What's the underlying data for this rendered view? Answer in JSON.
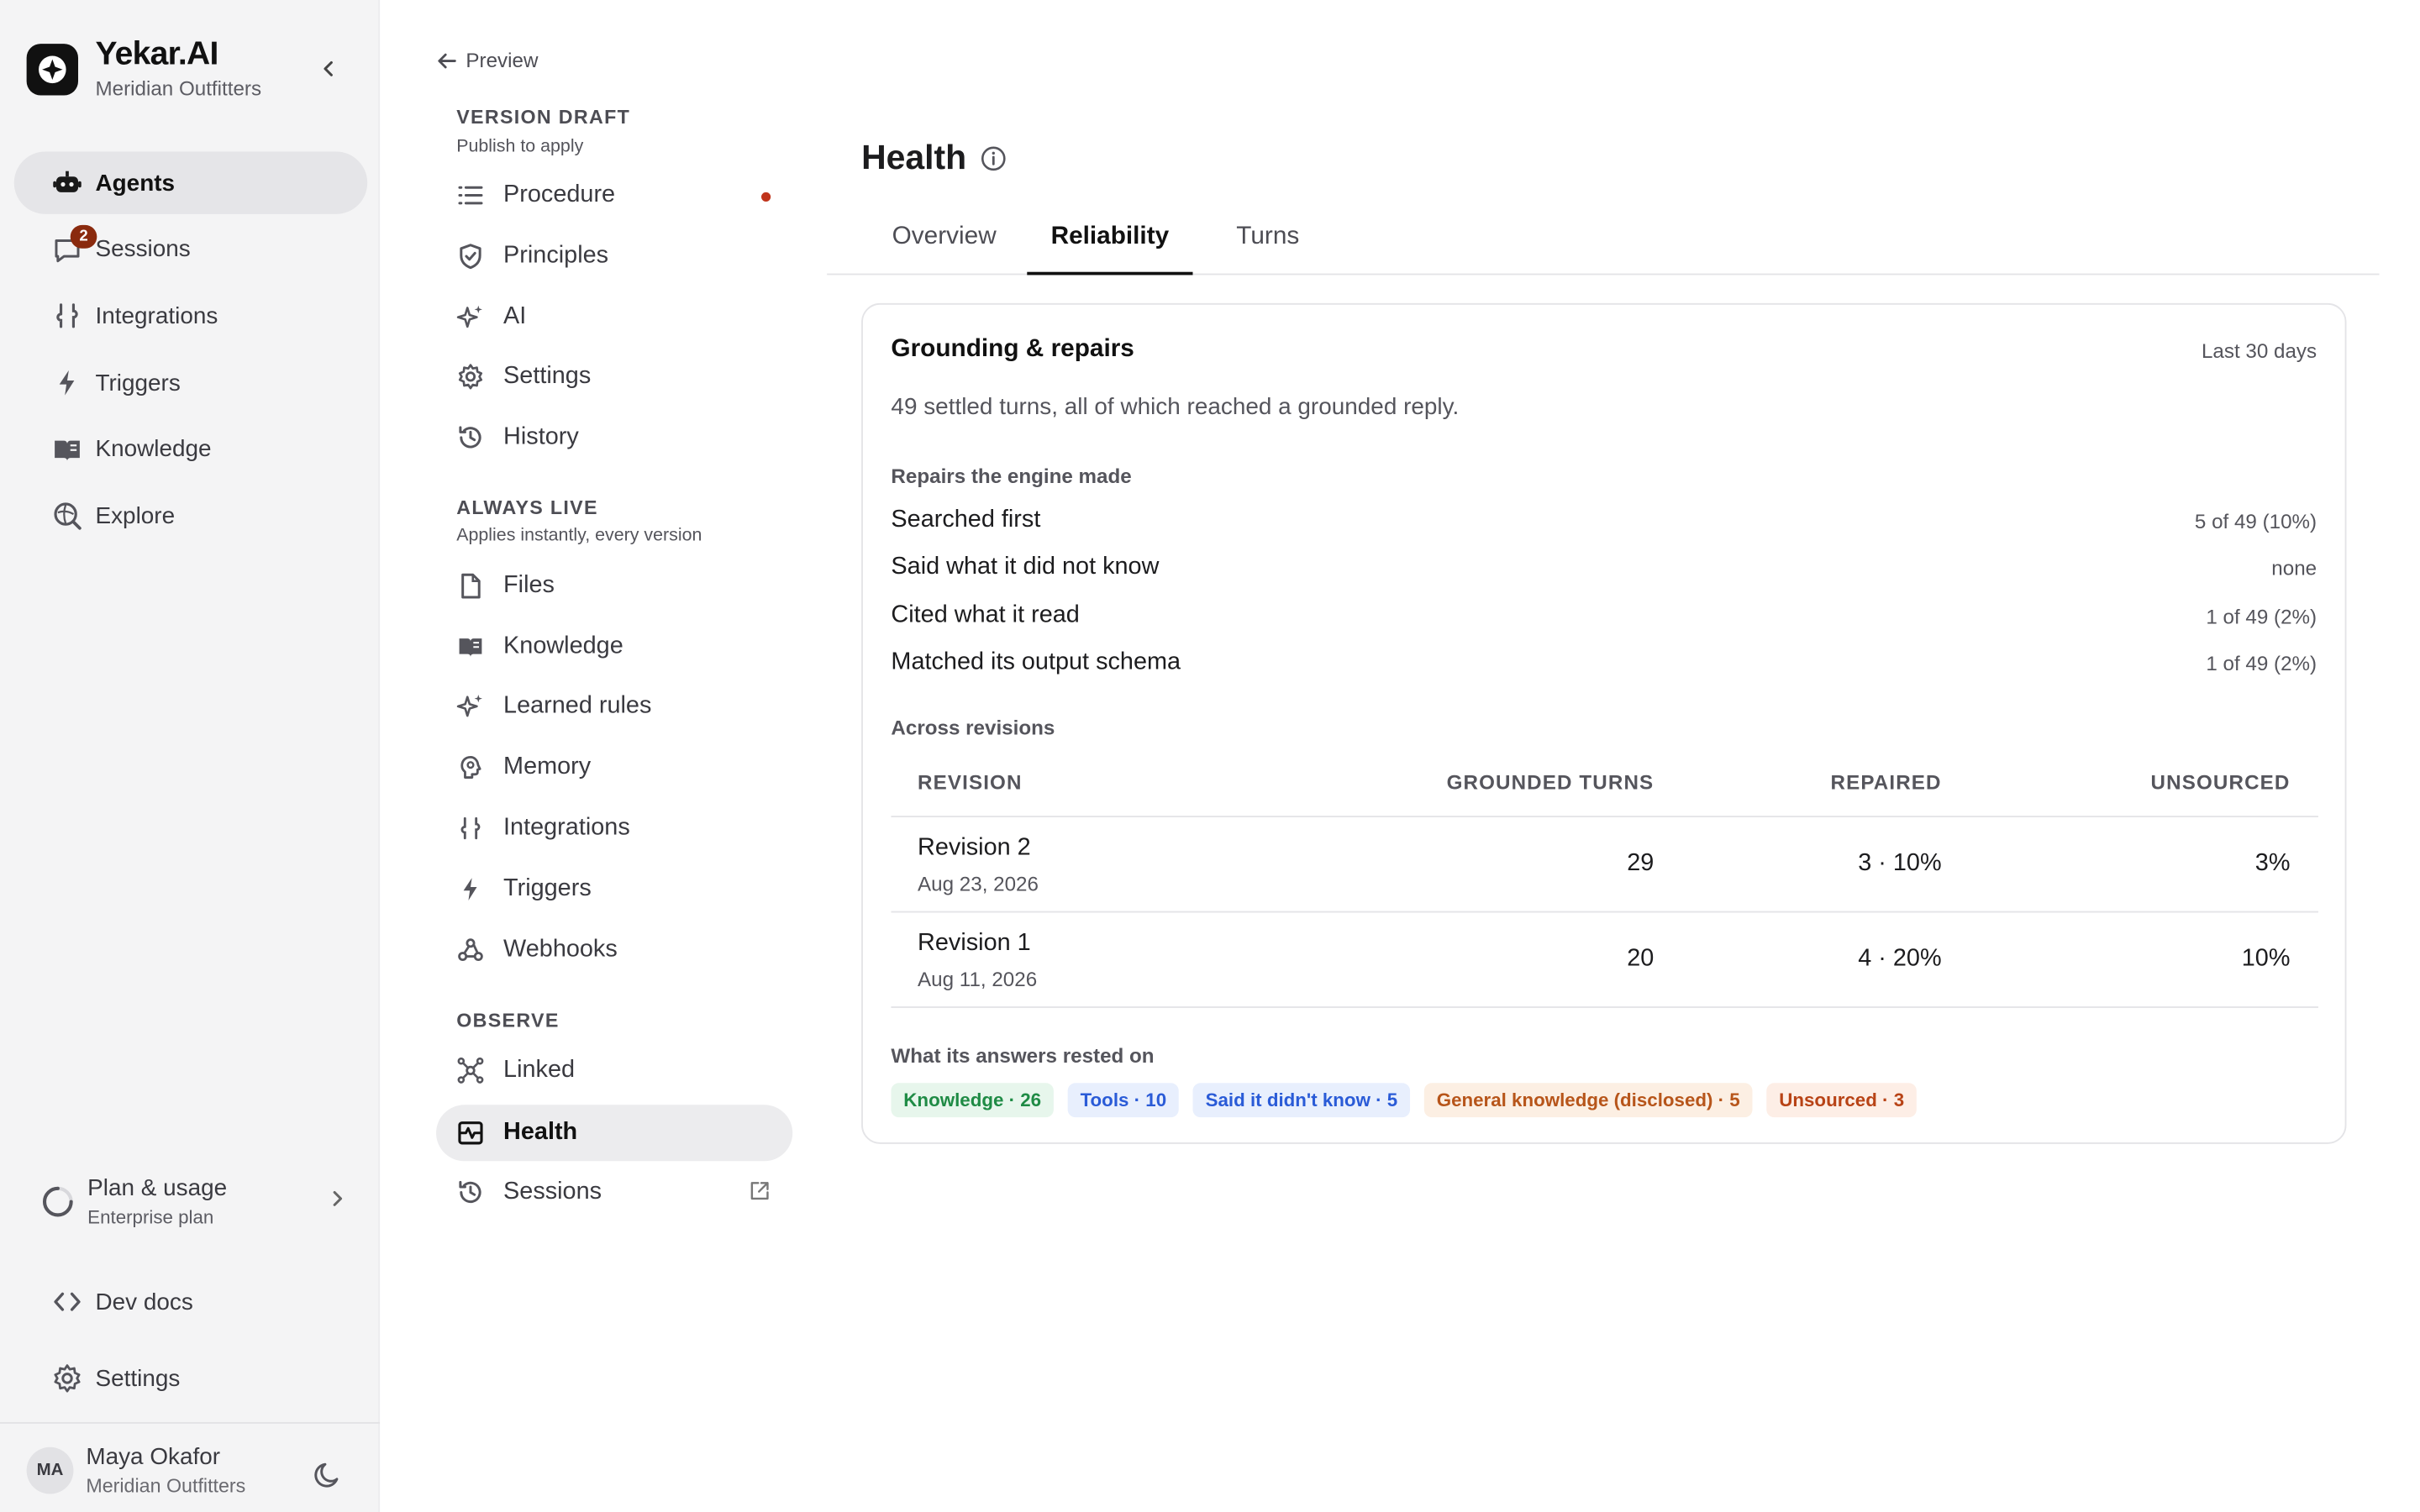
{
  "brand": {
    "name": "Yekar.AI",
    "org": "Meridian Outfitters"
  },
  "rail": {
    "items": [
      {
        "label": "Agents",
        "icon": "robot-icon",
        "active": true
      },
      {
        "label": "Sessions",
        "icon": "chat-icon",
        "badge": "2"
      },
      {
        "label": "Integrations",
        "icon": "plug-icon"
      },
      {
        "label": "Triggers",
        "icon": "bolt-icon"
      },
      {
        "label": "Knowledge",
        "icon": "book-icon"
      },
      {
        "label": "Explore",
        "icon": "search-globe-icon"
      }
    ],
    "plan": {
      "title": "Plan & usage",
      "subtitle": "Enterprise plan"
    },
    "dev_docs": "Dev docs",
    "settings": "Settings",
    "user": {
      "initials": "MA",
      "name": "Maya Okafor",
      "org": "Meridian Outfitters"
    }
  },
  "agent_nav": {
    "back": "Preview",
    "sections": [
      {
        "heading": "VERSION DRAFT",
        "subtitle": "Publish to apply",
        "items": [
          "Procedure",
          "Principles",
          "AI",
          "Settings",
          "History"
        ]
      },
      {
        "heading": "ALWAYS LIVE",
        "subtitle": "Applies instantly, every version",
        "items": [
          "Files",
          "Knowledge",
          "Learned rules",
          "Memory",
          "Integrations",
          "Triggers",
          "Webhooks"
        ]
      },
      {
        "heading": "OBSERVE",
        "items": [
          "Linked",
          "Health",
          "Sessions"
        ]
      }
    ]
  },
  "main": {
    "title": "Health",
    "tabs": [
      "Overview",
      "Reliability",
      "Turns"
    ],
    "active_tab": "Reliability",
    "card": {
      "title": "Grounding & repairs",
      "period": "Last 30 days",
      "summary": "49 settled turns, all of which reached a grounded reply.",
      "repairs_heading": "Repairs the engine made",
      "repairs": [
        {
          "label": "Searched first",
          "value": "5 of 49 (10%)"
        },
        {
          "label": "Said what it did not know",
          "value": "none"
        },
        {
          "label": "Cited what it read",
          "value": "1 of 49 (2%)"
        },
        {
          "label": "Matched its output schema",
          "value": "1 of 49 (2%)"
        }
      ],
      "revisions_heading": "Across revisions",
      "columns": [
        "REVISION",
        "GROUNDED TURNS",
        "REPAIRED",
        "UNSOURCED"
      ],
      "revisions": [
        {
          "name": "Revision 2",
          "date": "Aug 23, 2026",
          "grounded": "29",
          "repaired": "3 · 10%",
          "unsourced": "3%"
        },
        {
          "name": "Revision 1",
          "date": "Aug 11, 2026",
          "grounded": "20",
          "repaired": "4 · 20%",
          "unsourced": "10%"
        }
      ],
      "sources_heading": "What its answers rested on",
      "sources": [
        {
          "label": "Knowledge · 26",
          "color": "#1f8b45"
        },
        {
          "label": "Tools · 10",
          "color": "#2a5bd7"
        },
        {
          "label": "Said it didn't know · 5",
          "color": "#2a5bd7"
        },
        {
          "label": "General knowledge (disclosed) · 5",
          "color": "#b7551a"
        },
        {
          "label": "Unsourced · 3",
          "color": "#b84316"
        }
      ]
    }
  }
}
